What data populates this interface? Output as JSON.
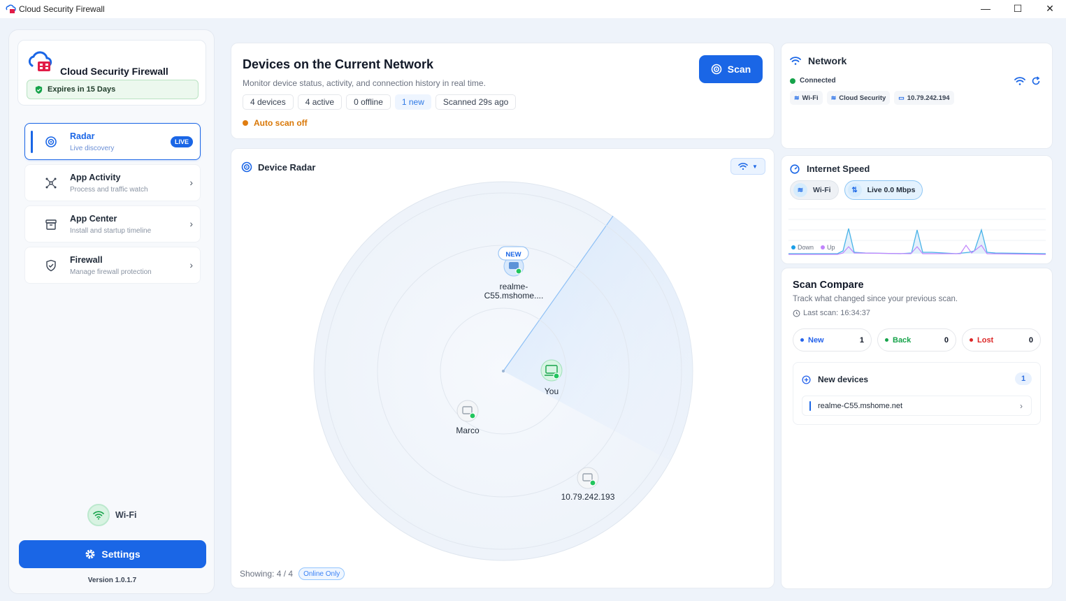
{
  "window": {
    "title": "Cloud Security Firewall",
    "min": "—",
    "max": "☐",
    "close": "✕"
  },
  "sidebar": {
    "brand": "Cloud Security Firewall",
    "expires": "Expires in 15 Days",
    "nav": [
      {
        "label": "Radar",
        "sub": "Live discovery",
        "badge": "LIVE"
      },
      {
        "label": "App Activity",
        "sub": "Process and traffic watch"
      },
      {
        "label": "App Center",
        "sub": "Install and startup timeline"
      },
      {
        "label": "Firewall",
        "sub": "Manage firewall protection"
      }
    ],
    "connection": "Wi-Fi",
    "settings": "Settings",
    "version": "Version 1.0.1.7"
  },
  "devices": {
    "title": "Devices on the Current Network",
    "subtitle": "Monitor device status, activity, and connection history in real time.",
    "chips": [
      "4 devices",
      "4 active",
      "0 offline",
      "1 new",
      "Scanned 29s ago"
    ],
    "autoscan": "Auto scan off",
    "scan_button": "Scan"
  },
  "radar": {
    "title": "Device Radar",
    "showing": "Showing: 4 / 4",
    "filter": "Online Only",
    "devices": [
      {
        "name": "realme-\nC55.mshome....",
        "badge": "NEW"
      },
      {
        "name": "You"
      },
      {
        "name": "Marco"
      },
      {
        "name": "10.79.242.193"
      }
    ]
  },
  "network": {
    "title": "Network",
    "status": "Connected",
    "pills": [
      "Wi-Fi",
      "Cloud Security",
      "10.79.242.194"
    ]
  },
  "speed": {
    "title": "Internet Speed",
    "wifi": "Wi-Fi",
    "live": "Live 0.0 Mbps",
    "legend_down": "Down",
    "legend_up": "Up"
  },
  "compare": {
    "title": "Scan Compare",
    "subtitle": "Track what changed since your previous scan.",
    "last_scan": "Last scan: 16:34:37",
    "stats": [
      {
        "label": "New",
        "value": "1",
        "color": "#2563eb"
      },
      {
        "label": "Back",
        "value": "0",
        "color": "#16a34a"
      },
      {
        "label": "Lost",
        "value": "0",
        "color": "#dc2626"
      }
    ],
    "new_devices_title": "New devices",
    "new_devices_count": "1",
    "new_device_name": "realme-C55.mshome.net"
  },
  "colors": {
    "accent": "#1a66e6",
    "success": "#16a34a",
    "warning": "#e07d10",
    "danger": "#dc2626"
  }
}
